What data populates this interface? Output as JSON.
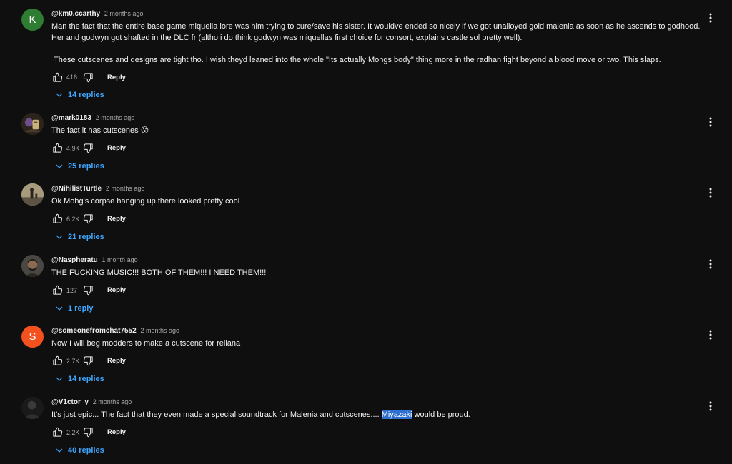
{
  "comments": [
    {
      "author": "@km0.ccarthy",
      "time": "2 months ago",
      "avatar_letter": "K",
      "avatar_color": "#2e7d32",
      "text": "Man the fact that the entire base game miquella lore was him trying to cure/save his sister. It wouldve ended so nicely if we got unalloyed gold malenia as soon as he ascends to godhood. Her and godwyn got shafted in the DLC fr (altho i do think godwyn was miquellas first choice for consort, explains castle sol pretty well).\n\n These cutscenes and designs are tight tho. I wish theyd leaned into the whole \"Its actually Mohgs body\" thing more in the radhan fight beyond a blood move or two. This slaps.",
      "likes": "416",
      "reply_label": "Reply",
      "replies_label": "14 replies"
    },
    {
      "author": "@mark0183",
      "time": "2 months ago",
      "text": "The fact it has cutscenes 😮",
      "likes": "4.9K",
      "reply_label": "Reply",
      "replies_label": "25 replies"
    },
    {
      "author": "@NihilistTurtle",
      "time": "2 months ago",
      "text": "Ok Mohg's corpse hanging up there looked pretty cool",
      "likes": "6.2K",
      "reply_label": "Reply",
      "replies_label": "21 replies"
    },
    {
      "author": "@Naspheratu",
      "time": "1 month ago",
      "text": "THE FUCKING MUSIC!!! BOTH OF THEM!!! I NEED THEM!!!",
      "likes": "127",
      "reply_label": "Reply",
      "replies_label": "1 reply"
    },
    {
      "author": "@someonefromchat7552",
      "time": "2 months ago",
      "avatar_letter": "S",
      "avatar_color": "#f4511e",
      "text": "Now I will beg modders to make a cutscene for rellana",
      "likes": "2.7K",
      "reply_label": "Reply",
      "replies_label": "14 replies"
    },
    {
      "author": "@V1ctor_y",
      "time": "2 months ago",
      "text_before": "It's just epic... The fact that they even made a special soundtrack for Malenia and cutscenes.... ",
      "text_highlight": "Miyazaki",
      "text_after": " would be proud.",
      "likes": "2.2K",
      "reply_label": "Reply",
      "replies_label": "40 replies"
    }
  ],
  "icons": {
    "like": "thumb-up-icon",
    "dislike": "thumb-down-icon",
    "menu": "more-vert-icon",
    "expand": "chevron-down-icon"
  },
  "colors": {
    "background": "#0f0f0f",
    "link_blue": "#3ea6ff",
    "highlight": "#2f6fd1"
  }
}
